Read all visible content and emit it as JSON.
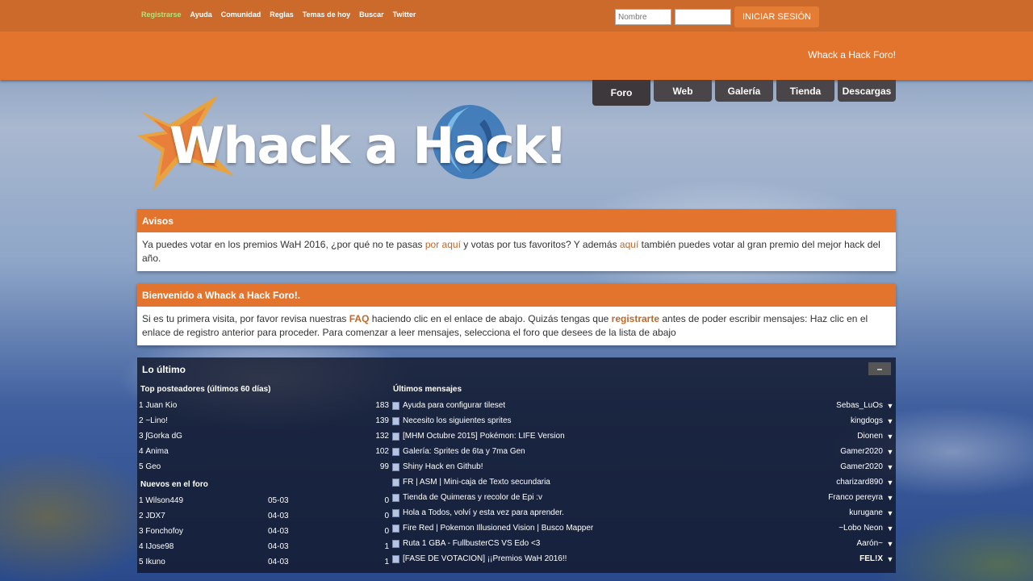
{
  "topnav": {
    "items": [
      "Registrarse",
      "Ayuda",
      "Comunidad",
      "Reglas",
      "Temas de hoy",
      "Buscar",
      "Twitter"
    ]
  },
  "login": {
    "username_placeholder": "Nombre",
    "password_placeholder": "",
    "submit_label": "INICIAR SESIÓN"
  },
  "header": {
    "site_name": "Whack a Hack Foro!"
  },
  "tabs": [
    "Foro",
    "Web",
    "Galería",
    "Tienda",
    "Descargas"
  ],
  "logo": {
    "text": "Whack a Hack!"
  },
  "avisos": {
    "title": "Avisos",
    "text_1": "Ya puedes votar en los premios WaH 2016, ¿por qué no te pasas ",
    "link_1": "por aquí",
    "text_2": " y votas por tus favoritos? Y además ",
    "link_2": "aquí",
    "text_3": " también puedes votar al gran premio del mejor hack del año."
  },
  "welcome": {
    "title": "Bienvenido a Whack a Hack Foro!.",
    "text_1": "Si es tu primera visita, por favor revisa nuestras ",
    "link_faq": "FAQ",
    "text_2": " haciendo clic en el enlace de abajo. Quizás tengas que ",
    "link_register": "registrarte",
    "text_3": " antes de poder escribir mensajes: Haz clic en el enlace de registro anterior para proceder. Para comenzar a leer mensajes, selecciona el foro que desees de la lista de abajo"
  },
  "latest": {
    "title": "Lo último",
    "collapse_label": "–",
    "top_posters_title": "Top posteadores (últimos 60 días)",
    "top_posters": [
      {
        "rank": "1",
        "name": "Juan Kio",
        "count": "183"
      },
      {
        "rank": "2",
        "name": "~Lino!",
        "count": "139"
      },
      {
        "rank": "3",
        "name": "ʃGorka dG",
        "count": "132"
      },
      {
        "rank": "4",
        "name": "Ánima",
        "count": "102"
      },
      {
        "rank": "5",
        "name": "Geo",
        "count": "99"
      }
    ],
    "new_members_title": "Nuevos en el foro",
    "new_members": [
      {
        "rank": "1",
        "name": "Wilson449",
        "date": "05-03",
        "count": "0"
      },
      {
        "rank": "2",
        "name": "JDX7",
        "date": "04-03",
        "count": "0"
      },
      {
        "rank": "3",
        "name": "Fonchofoy",
        "date": "04-03",
        "count": "0"
      },
      {
        "rank": "4",
        "name": "IJose98",
        "date": "04-03",
        "count": "1"
      },
      {
        "rank": "5",
        "name": "Ikuno",
        "date": "04-03",
        "count": "1"
      }
    ],
    "latest_posts_title": "Últimos mensajes",
    "posts": [
      {
        "title": "Ayuda para configurar tileset",
        "poster": "Sebas_LuOs",
        "bold": false
      },
      {
        "title": "Necesito los siguientes sprites",
        "poster": "kingdogs",
        "bold": false
      },
      {
        "title": "[MHM Octubre 2015] Pokémon: LIFE Version",
        "poster": "Dionen",
        "bold": false
      },
      {
        "title": "Galería: Sprites de 6ta y 7ma Gen",
        "poster": "Gamer2020",
        "bold": false
      },
      {
        "title": "Shiny Hack en Github!",
        "poster": "Gamer2020",
        "bold": false
      },
      {
        "title": "FR | ASM | Mini-caja de Texto secundaria",
        "poster": "charizard890",
        "bold": false
      },
      {
        "title": "Tienda de Quimeras y recolor de Epi :v",
        "poster": "Franco pereyra",
        "bold": false
      },
      {
        "title": "Hola a Todos, volví y esta vez para aprender.",
        "poster": "kurugane",
        "bold": false
      },
      {
        "title": "Fire Red | Pokemon Illusioned Vision | Busco Mapper",
        "poster": "~Lobo Neon",
        "bold": false
      },
      {
        "title": "Ruta 1 GBA - FullbusterCS VS Edo <3",
        "poster": "Aarón~",
        "bold": false
      },
      {
        "title": "[FASE DE VOTACIÓN] ¡¡Premios WaH 2016!!",
        "poster": "FEL!X",
        "bold": true
      }
    ],
    "arrow": "▼"
  },
  "colors": {
    "topbar": "#cc6a2c",
    "header": "#e2742d",
    "tab": "#4a4548",
    "link": "#c0672a",
    "register_link": "#b8e07a"
  }
}
